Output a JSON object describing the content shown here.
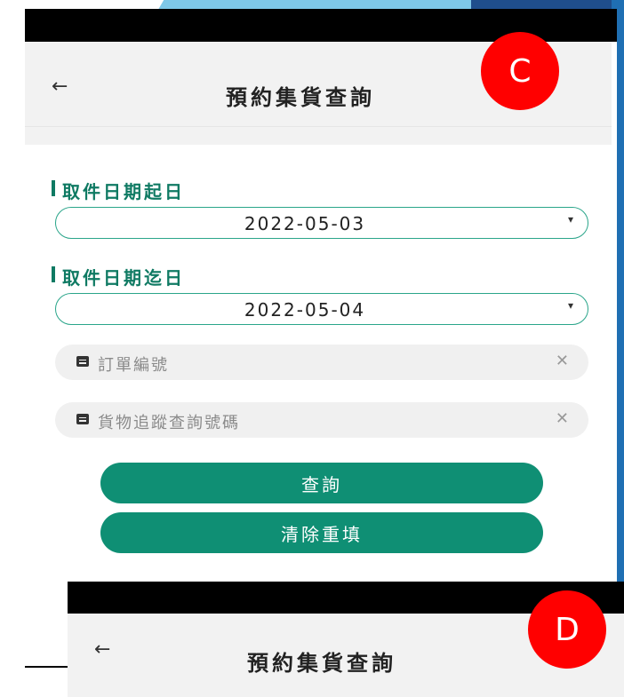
{
  "panel_c": {
    "header": {
      "back_symbol": "←",
      "title": "預約集貨查詢"
    },
    "badge": "C",
    "form": {
      "start_date_label": "取件日期起日",
      "start_date_value": "2022-05-03",
      "end_date_label": "取件日期迄日",
      "end_date_value": "2022-05-04",
      "order_number_placeholder": "訂單編號",
      "tracking_number_placeholder": "貨物追蹤查詢號碼",
      "search_button": "查詢",
      "reset_button": "清除重填",
      "clear_symbol": "✕",
      "caret_symbol": "▾"
    }
  },
  "panel_d": {
    "header": {
      "back_symbol": "←",
      "title": "預約集貨查詢"
    },
    "badge": "D"
  },
  "colors": {
    "accent_green": "#0f8f74",
    "label_green": "#0f7a63",
    "badge_red": "#ff0000",
    "slide_blue_light": "#7ec8e8",
    "slide_blue_dark": "#1f4e8c"
  },
  "icons": {
    "back": "arrow-left-icon",
    "dropdown": "caret-down-icon",
    "document": "document-icon",
    "clear": "clear-icon"
  }
}
